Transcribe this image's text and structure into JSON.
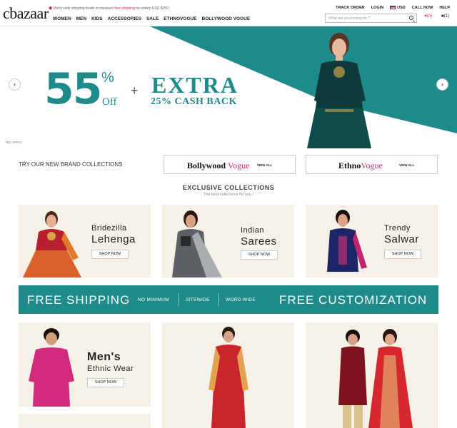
{
  "header": {
    "logo": "cbazaar",
    "tagline_prefix": "Word wide shipping made to measure",
    "tagline_highlight": "free shipping",
    "tagline_suffix": "on orders USD $250",
    "nav": [
      "WOMEN",
      "MEN",
      "KIDS",
      "ACCESSORIES",
      "SALE",
      "ETHNOVOGUE",
      "BOLLYWOOD VOGUE"
    ],
    "toplinks": [
      "TRACK ORDER",
      "LOGIN",
      "USD",
      "CALL NOW",
      "HELP"
    ],
    "search_placeholder": "What are you looking for ?",
    "wishlist_count": "(0)",
    "bag_count": "(1)"
  },
  "hero": {
    "discount": "55",
    "percent": "%",
    "off": "Off",
    "plus": "+",
    "extra": "EXTRA",
    "cashback": "25% CASH BACK",
    "tc": "T&C APPLY",
    "prev": "‹",
    "next": "›"
  },
  "brands": {
    "label": "TRY OUR NEW BRAND COLLECTIONS",
    "items": [
      {
        "name1": "Bollywood",
        "name2": "Vogue",
        "view": "VIEW ALL"
      },
      {
        "name1": "Ethno",
        "name2": "Vogue",
        "view": "VIEW ALL"
      }
    ]
  },
  "exclusive": {
    "title": "EXCLUSIVE COLLECTIONS",
    "subtitle": "The best collections for you !"
  },
  "cards": [
    {
      "line1": "Bridezilla",
      "line2": "Lehenga",
      "shop": "SHOP NOW"
    },
    {
      "line1": "Indian",
      "line2": "Sarees",
      "shop": "SHOP NOW"
    },
    {
      "line1": "Trendy",
      "line2": "Salwar",
      "shop": "SHOP NOW"
    },
    {
      "line1": "Men's",
      "line2": "Ethnic Wear",
      "shop": "SHOP NOW"
    }
  ],
  "shipping": {
    "free_shipping": "FREE SHIPPING",
    "no_minimum": "NO MINIMUM",
    "sitewide": "SITEWIDE",
    "word_wide": "WORD WIDE",
    "free_customization": "FREE CUSTOMIZATION"
  },
  "colors": {
    "teal": "#1e8a8a",
    "pink": "#d6246e",
    "card_bg": "#f6f1e6"
  }
}
